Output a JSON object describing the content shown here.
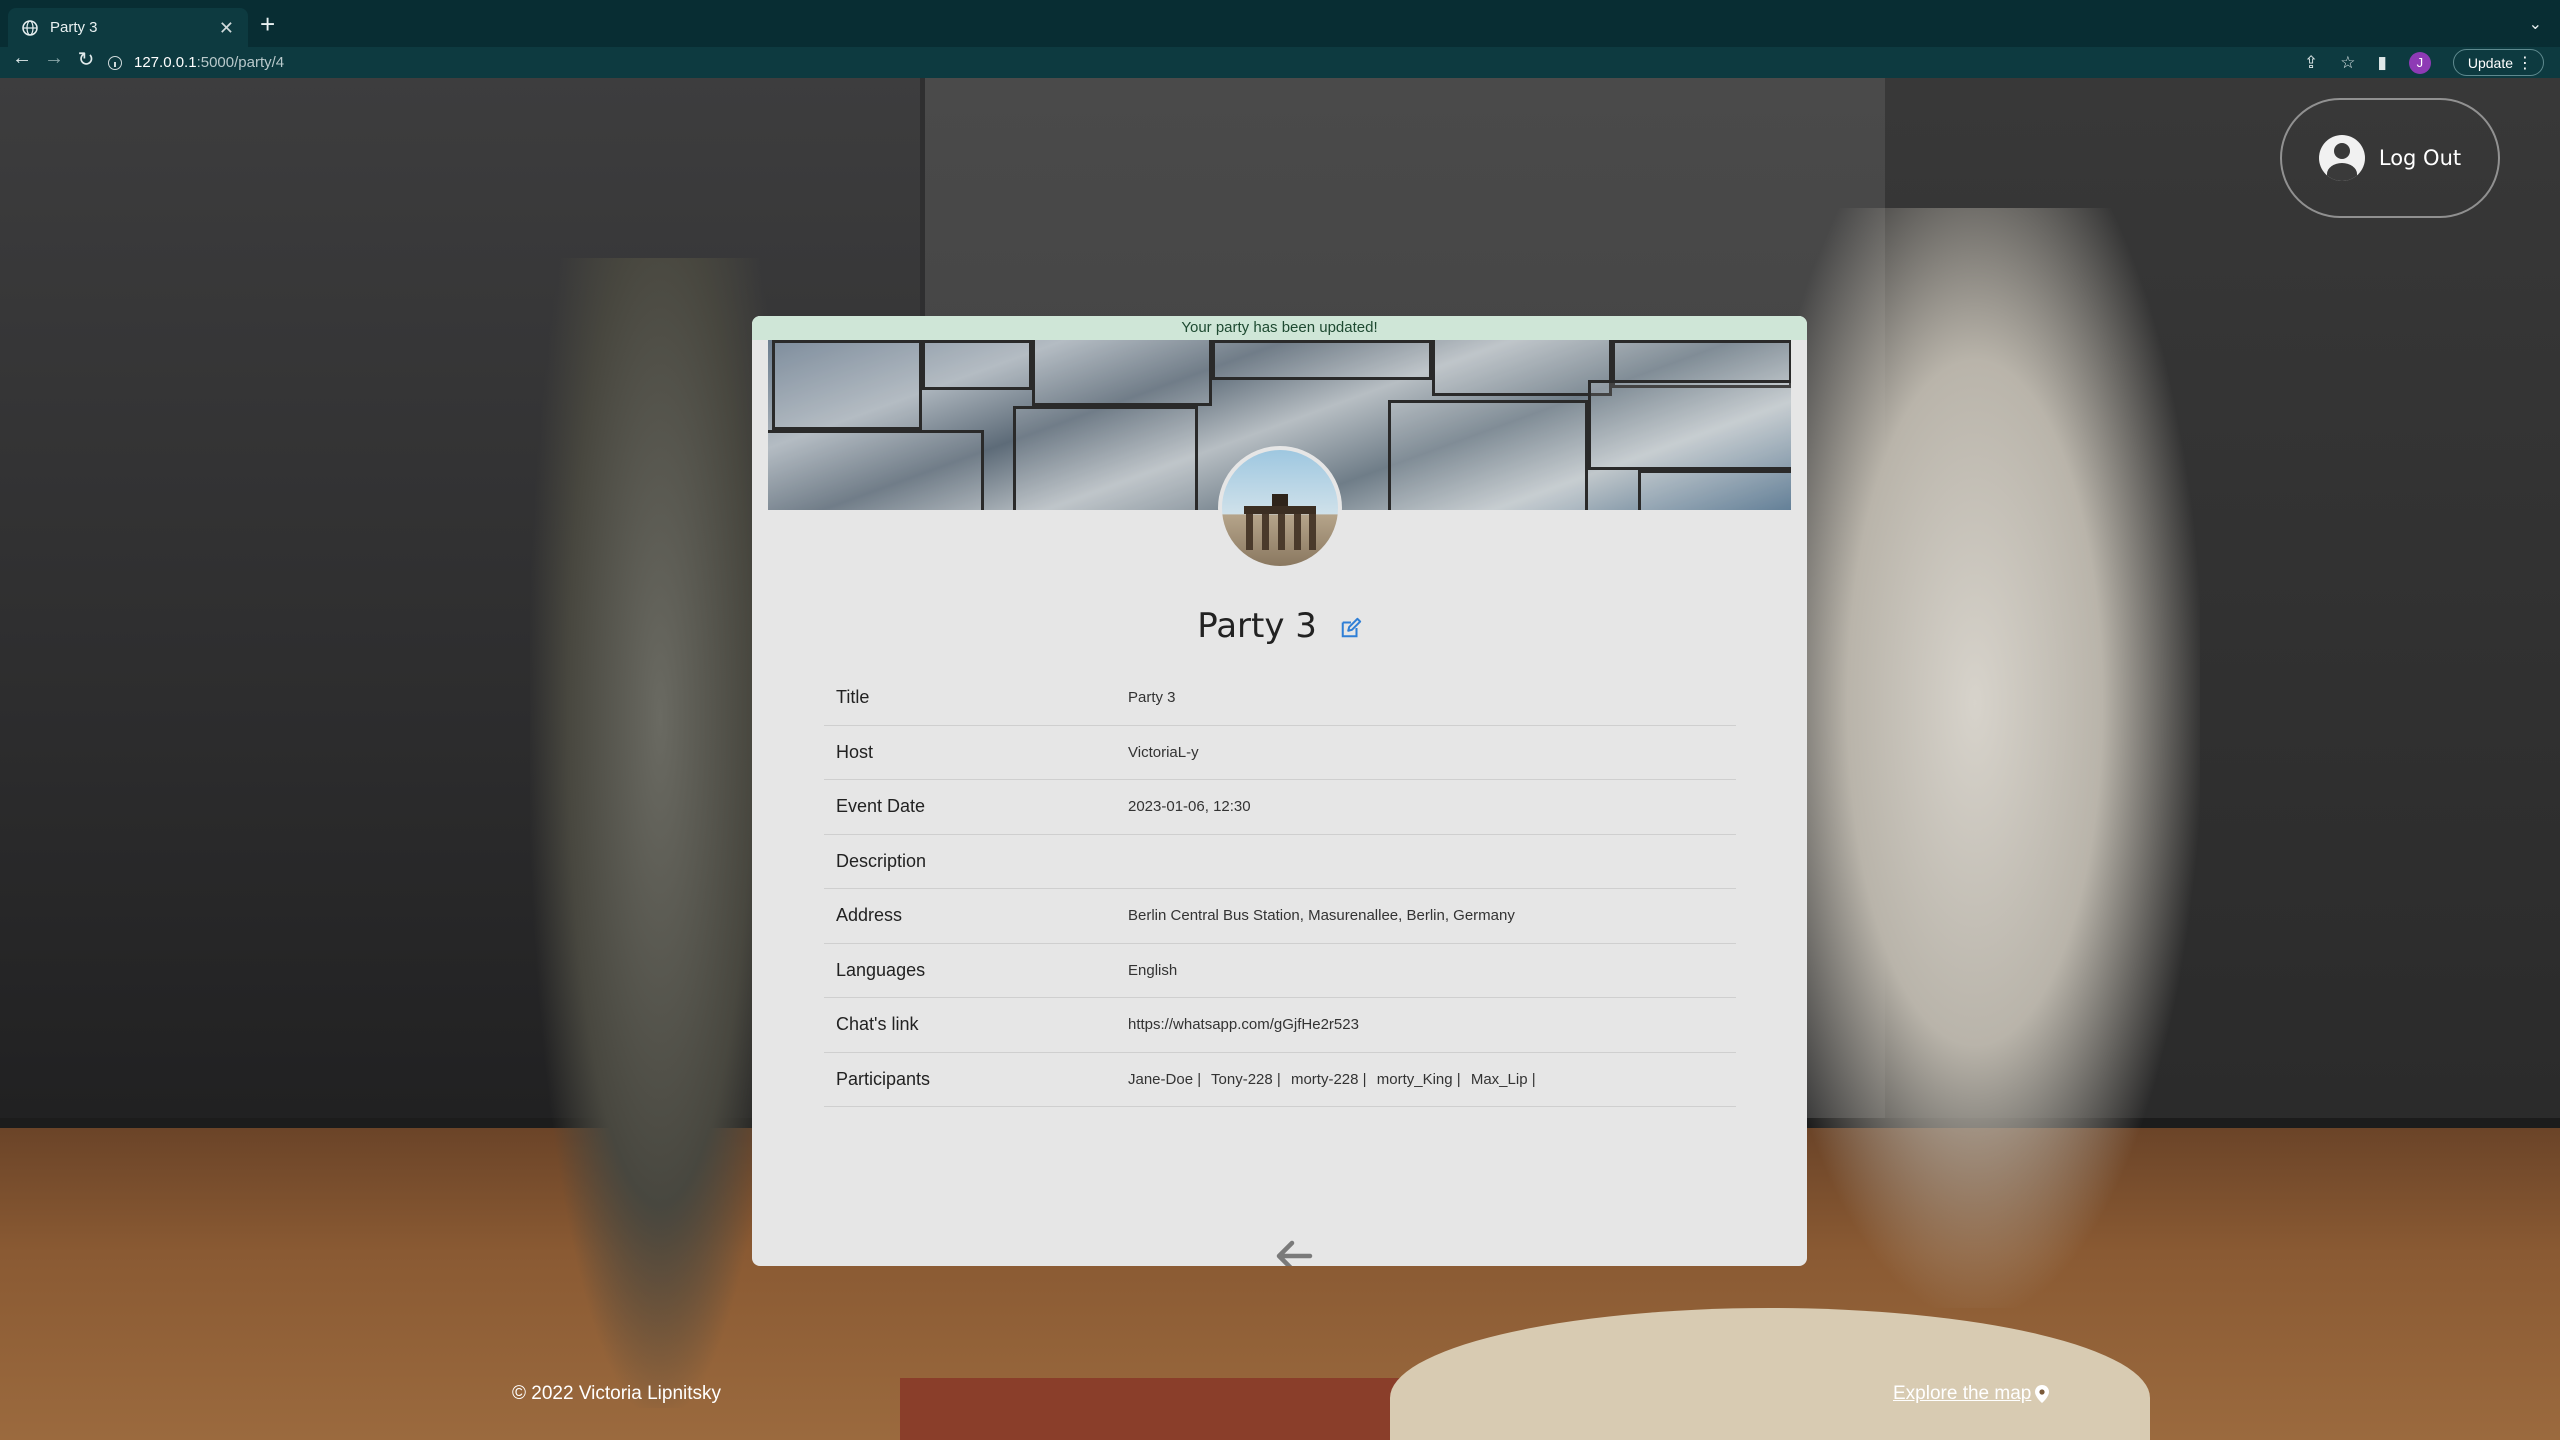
{
  "browser": {
    "tab_title": "Party 3",
    "url_host": "127.0.0.1",
    "url_path": ":5000/party/4",
    "profile_initial": "J",
    "update_label": "Update"
  },
  "header": {
    "logout_label": "Log Out"
  },
  "flash": {
    "message": "Your party has been updated!"
  },
  "party": {
    "heading": "Party 3",
    "rows": [
      {
        "label": "Title",
        "value": "Party 3"
      },
      {
        "label": "Host",
        "value": "VictoriaL-y"
      },
      {
        "label": "Event Date",
        "value": "2023-01-06, 12:30"
      },
      {
        "label": "Description",
        "value": ""
      },
      {
        "label": "Address",
        "value": "Berlin Central Bus Station, Masurenallee, Berlin, Germany"
      },
      {
        "label": "Languages",
        "value": "English"
      },
      {
        "label": "Chat's link",
        "value": "https://whatsapp.com/gGjfHe2r523"
      },
      {
        "label": "Participants",
        "value": ""
      }
    ],
    "participants": [
      "Jane-Doe |",
      "Tony-228 |",
      "morty-228 |",
      "morty_King |",
      "Max_Lip |"
    ]
  },
  "footer": {
    "copyright": "© 2022 Victoria Lipnitsky",
    "explore_map": "Explore the map"
  },
  "colors": {
    "chrome_bg": "#0d3a40",
    "card_bg": "#e6e6e6",
    "flash_bg": "#cfe6d7",
    "edit_icon": "#2f7fd6"
  }
}
